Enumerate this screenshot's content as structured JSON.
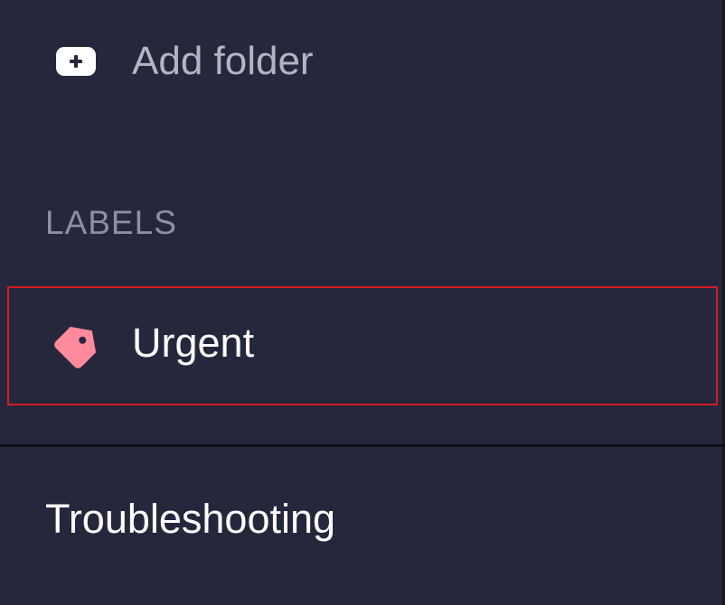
{
  "folders": {
    "add_label": "Add folder",
    "add_icon": "plus-square-icon"
  },
  "labels_section": {
    "heading": "LABELS",
    "items": [
      {
        "label": "Urgent",
        "icon": "tag-icon",
        "color": "#ff8a9b"
      }
    ]
  },
  "footer": {
    "troubleshooting_label": "Troubleshooting"
  },
  "colors": {
    "background": "#25273d",
    "selection_outline": "#d31b24",
    "muted_text": "#b3b5c6",
    "heading_text": "#8d8fa3"
  }
}
